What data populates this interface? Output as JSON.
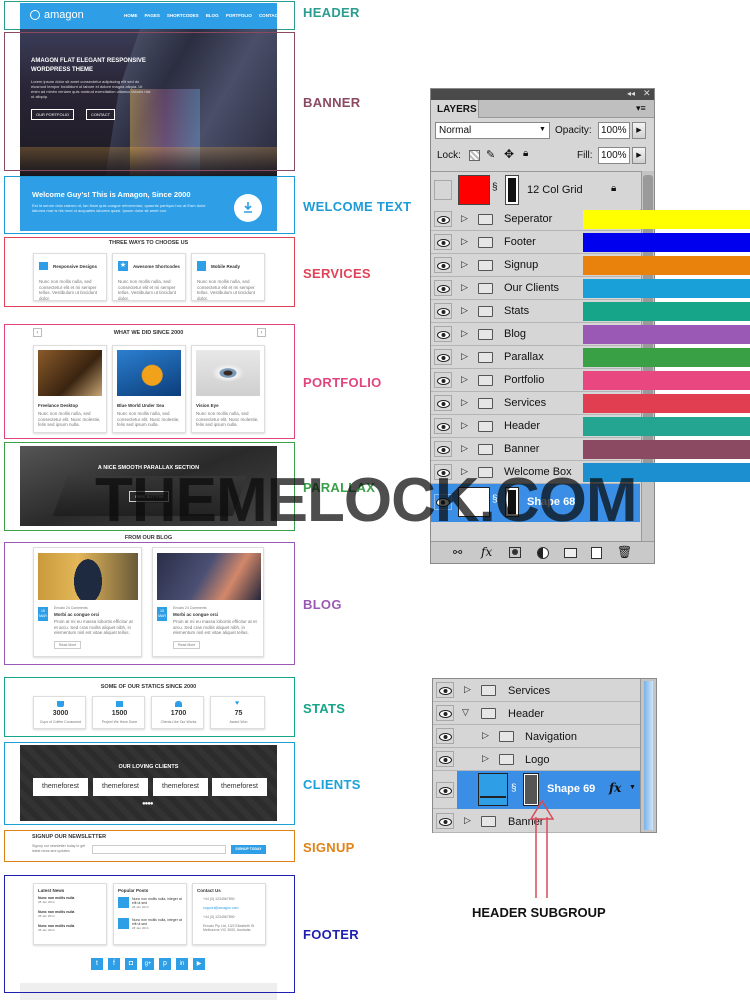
{
  "mockup": {
    "logo": "amagon",
    "nav": [
      "HOME",
      "PAGES",
      "SHORTCODES",
      "BLOG",
      "PORTFOLIO",
      "CONTACT"
    ],
    "banner_heading": "AMAGON FLAT ELEGANT RESPONSIVE WORDPRESS THEME",
    "banner_text": "Lorem ipsum dolor sit amet consectetur adipiscing elit sed do eiusmod tempor incididunt ut labore et dolore magna aliqua. Ut enim ad minim veniam quis nostrud exercitation ullamco laboris nisi ut aliquip.",
    "banner_btn1": "OUR PORTFOLIO",
    "banner_btn2": "CONTACT",
    "welcome_title": "Welcome Guy's! This is Amagon, Since 2000",
    "welcome_text": "Est id serum dolo ratemo nt, lan Nam quis congue reformentur, quaunts partiquu hoc at Eam dolor laborea mar is his mod ut acquaties laborea quasi. Ipsum dolor sit amet con.",
    "services_title": "THREE WAYS TO CHOOSE US",
    "services": [
      {
        "title": "Responsive Designs",
        "text": "Nunc non mollis nulla, sed consectetur elit et mi semper tellus. Vestibulum ut tincidunt dolor."
      },
      {
        "title": "Awesome Shortcodes",
        "text": "Nunc non mollis nulla, sed consectetur elit et mi semper tellus. Vestibulum ut tincidunt dolor."
      },
      {
        "title": "Mobile Ready",
        "text": "Nunc non mollis nulla, sed consectetur elit et mi semper tellus. Vestibulum ut tincidunt dolor."
      }
    ],
    "portfolio_title": "WHAT WE DID SINCE 2000",
    "portfolio": [
      {
        "title": "Freelance Desktop",
        "text": "Nunc non mollis nulla, sed consectetur elit. Nunc molestie, felis sed ipsum nulla."
      },
      {
        "title": "Blue World Under Sea",
        "text": "Nunc non mollis nulla, sed consectetur elit. Nunc molestie, felis sed ipsum nulla."
      },
      {
        "title": "Vision Eye",
        "text": "Nunc non mollis nulla, sed consectetur elit. Nunc molestie, felis sed ipsum nulla."
      }
    ],
    "parallax_title": "A NICE SMOOTH PARALLAX SECTION",
    "parallax_btn": "FREE BUTTON",
    "blog_title": "FROM OUR BLOG",
    "blog": [
      {
        "day": "15",
        "month": "MAR",
        "meta": "Envato   24 Comments",
        "title": "Morbi ac congue orci",
        "text": "Proin at mi eu massa lobortis efficitur at et arcu. Sed cras mollis aliquet nibh, in elementum nisl est vitae aliquet tellus.",
        "btn": "Read More"
      },
      {
        "day": "15",
        "month": "MAR",
        "meta": "Envato   24 Comments",
        "title": "Morbi ac congue orci",
        "text": "Proin at mi eu massa lobortis efficitur at et arcu. Sed cras mollis aliquet nibh, in elementum nisl est vitae aliquet tellus.",
        "btn": "Read More"
      }
    ],
    "stats_title": "SOME OF OUR STATICS SINCE 2000",
    "stats": [
      {
        "value": "3000",
        "label": "Cups of Coffee Consumed"
      },
      {
        "value": "1500",
        "label": "Project We Have Done"
      },
      {
        "value": "1700",
        "label": "Clients Like Our Works"
      },
      {
        "value": "75",
        "label": "Award Won"
      }
    ],
    "clients_title": "OUR LOVING CLIENTS",
    "client_logo": "themeforest",
    "signup_title": "SIGNUP OUR NEWSLETTER",
    "signup_text": "Signup our newsletter today to get latest news and updates",
    "signup_btn": "SIGNUP TODAY",
    "footer_cols": [
      "Latest News",
      "Popular Posts",
      "Contact Us"
    ],
    "latest_news": [
      {
        "title": "Nunc non mollis nulla",
        "date": "28 Jan 2014"
      },
      {
        "title": "Nunc non mollis nulla",
        "date": "28 Jan 2014"
      },
      {
        "title": "Nunc non mollis nulla",
        "date": "28 Jan 2014"
      }
    ],
    "popular_posts": [
      {
        "title": "Nunc non mollis nulla, integer at elit ut sed",
        "date": "28 Jan 2014"
      },
      {
        "title": "Nunc non mollis nulla, integer at elit ut sed",
        "date": "28 Jan 2014"
      }
    ],
    "contact": [
      "+44 (0) 1234567890",
      "support@amagon.com",
      "+44 (0) 1234567890",
      "Envato Pty Ltd, 13/2 Elizabeth St Melbourne VIC 3000, Australia"
    ]
  },
  "section_labels": [
    {
      "text": "HEADER",
      "color": "#2a9d8f"
    },
    {
      "text": "BANNER",
      "color": "#8b4a62"
    },
    {
      "text": "WELCOME TEXT",
      "color": "#1e9bd7"
    },
    {
      "text": "SERVICES",
      "color": "#e04358"
    },
    {
      "text": "PORTFOLIO",
      "color": "#e0457e"
    },
    {
      "text": "PARALLAX",
      "color": "#3aa04a"
    },
    {
      "text": "BLOG",
      "color": "#9b59b6"
    },
    {
      "text": "STATS",
      "color": "#17a589"
    },
    {
      "text": "CLIENTS",
      "color": "#1ba1d8"
    },
    {
      "text": "SIGNUP",
      "color": "#e08214"
    },
    {
      "text": "FOOTER",
      "color": "#1f1fb0"
    }
  ],
  "layers_panel": {
    "tab": "LAYERS",
    "blend_mode": "Normal",
    "opacity_label": "Opacity:",
    "opacity": "100%",
    "lock_label": "Lock:",
    "fill_label": "Fill:",
    "fill": "100%",
    "grid_layer": "12 Col Grid",
    "layers": [
      {
        "name": "Seperator",
        "color": "#ffff00"
      },
      {
        "name": "Footer",
        "color": "#0000ee"
      },
      {
        "name": "Signup",
        "color": "#e8820c"
      },
      {
        "name": "Our Clients",
        "color": "#1aa0d8"
      },
      {
        "name": "Stats",
        "color": "#17a589"
      },
      {
        "name": "Blog",
        "color": "#9b59b6"
      },
      {
        "name": "Parallax",
        "color": "#3aa045"
      },
      {
        "name": "Portfolio",
        "color": "#e8487f"
      },
      {
        "name": "Services",
        "color": "#e23e52"
      },
      {
        "name": "Header",
        "color": "#24a592"
      },
      {
        "name": "Banner",
        "color": "#8b4a62"
      },
      {
        "name": "Welcome Box",
        "color": "#1c8fd0"
      }
    ],
    "selected_layer": "Shape 68"
  },
  "watermark": "THEMELOCK.COM",
  "subgroup_panel": {
    "rows": [
      "Services",
      "Header",
      "Navigation",
      "Logo",
      "Shape 69",
      "Banner"
    ],
    "fx": "fx"
  },
  "caption": "HEADER SUBGROUP"
}
